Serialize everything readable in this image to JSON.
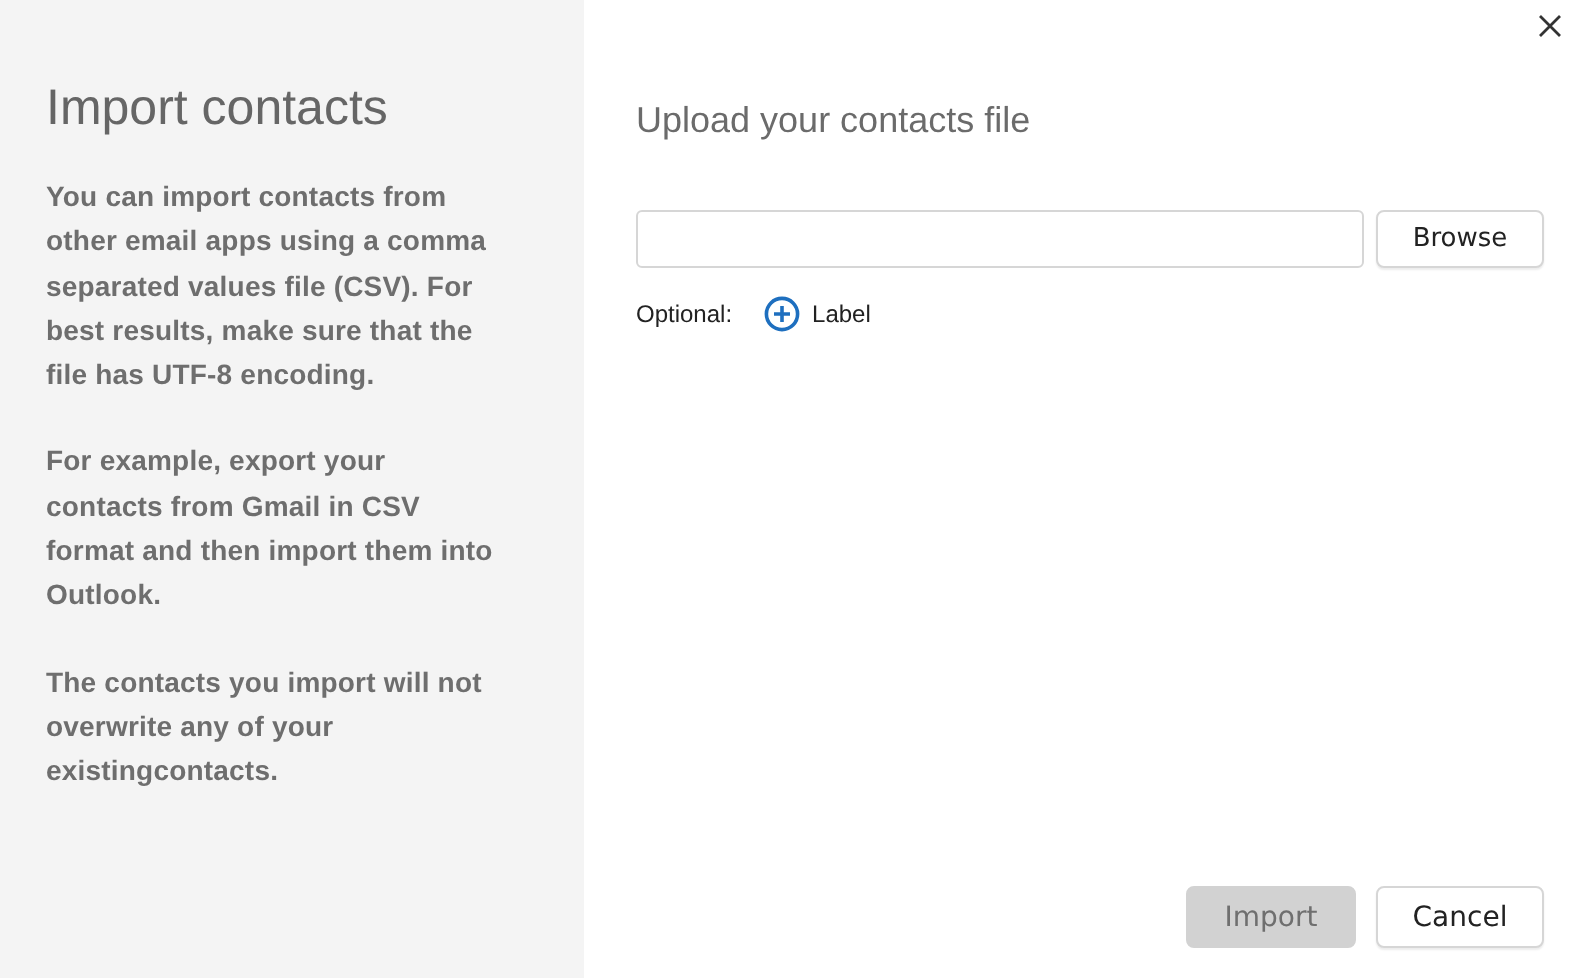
{
  "sidebar": {
    "title": "Import contacts",
    "paragraphs": [
      "You can import contacts from other email apps using a comma separated values file (CSV). For best results, make sure that the file has UTF-8 encoding.",
      "For example, export your contacts from Gmail in CSV format and then import them into Outlook.",
      "The contacts you import will not overwrite any of your existingcontacts."
    ]
  },
  "main": {
    "title": "Upload your contacts file",
    "browse_button": "Browse",
    "optional_label": "Optional:",
    "add_label_button": "Label"
  },
  "buttons": [
    {
      "label": "Import",
      "disabled": true
    },
    {
      "label": "Cancel",
      "disabled": false
    }
  ]
}
